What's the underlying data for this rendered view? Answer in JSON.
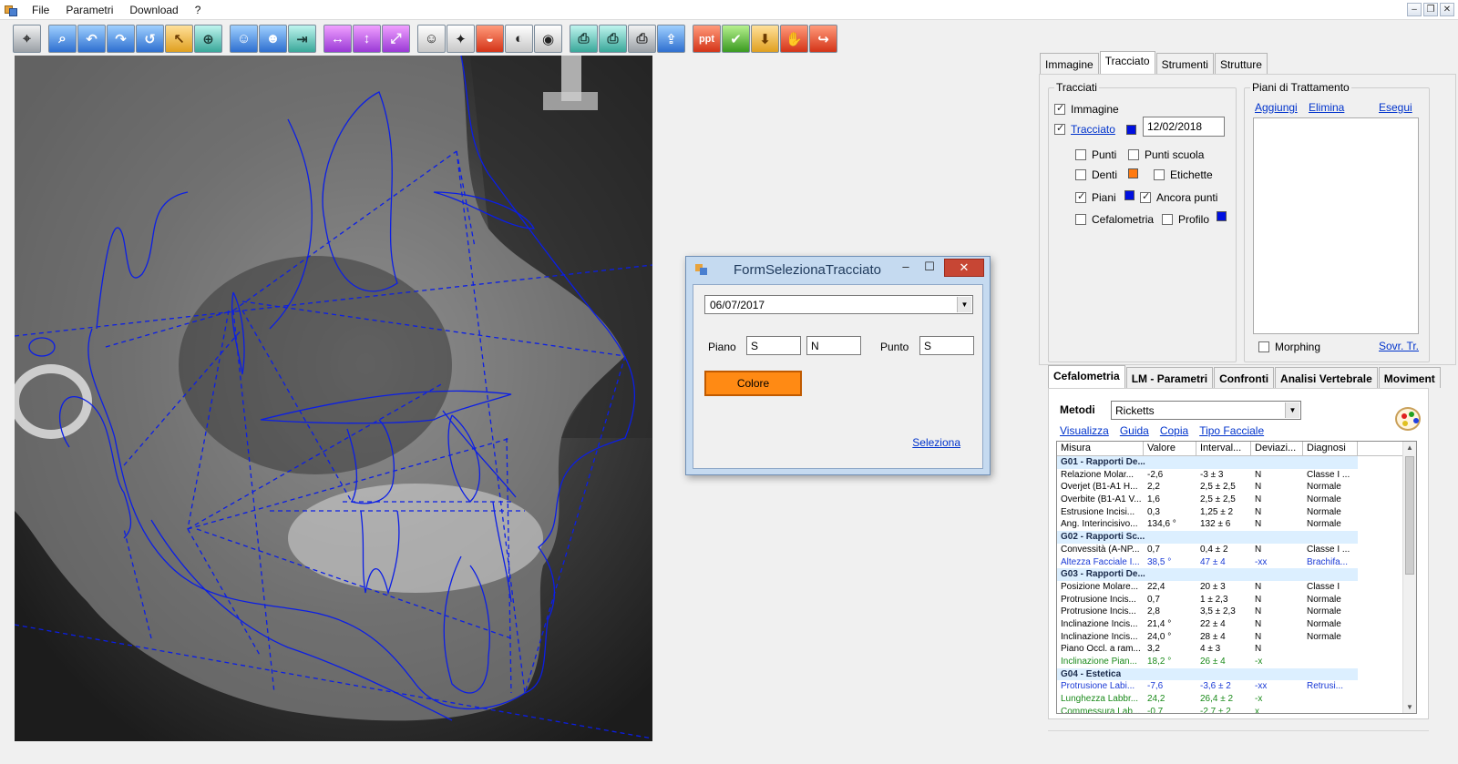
{
  "menu": {
    "items": [
      "File",
      "Parametri",
      "Download",
      "?"
    ]
  },
  "toolbar": {
    "groups": [
      [
        {
          "icon": "ruler-icon",
          "style": "tb-gray",
          "glyph": "⌖"
        }
      ],
      [
        {
          "icon": "zoom-icon",
          "style": "tb-blue",
          "glyph": "⌕"
        },
        {
          "icon": "rotate-left-icon",
          "style": "tb-blue",
          "glyph": "↶"
        },
        {
          "icon": "rotate-right-icon",
          "style": "tb-blue",
          "glyph": "↷"
        },
        {
          "icon": "reset-view-icon",
          "style": "tb-blue",
          "glyph": "↺"
        },
        {
          "icon": "pointer-icon",
          "style": "tb-orange",
          "glyph": "↖"
        },
        {
          "icon": "magnifier-icon",
          "style": "tb-teal",
          "glyph": "⊕"
        }
      ],
      [
        {
          "icon": "patient-icon",
          "style": "tb-blue",
          "glyph": "☺"
        },
        {
          "icon": "patient-search-icon",
          "style": "tb-blue",
          "glyph": "☻"
        },
        {
          "icon": "import-icon",
          "style": "tb-teal",
          "glyph": "⇥"
        }
      ],
      [
        {
          "icon": "flip-horizontal-icon",
          "style": "tb-purple",
          "glyph": "↔"
        },
        {
          "icon": "flip-vertical-icon",
          "style": "tb-purple",
          "glyph": "↕"
        },
        {
          "icon": "resize-icon",
          "style": "tb-purple",
          "glyph": "⤢"
        }
      ],
      [
        {
          "icon": "profile-photo-icon",
          "style": "tb-dark",
          "glyph": "☺"
        },
        {
          "icon": "wand-icon",
          "style": "tb-dark",
          "glyph": "✦"
        },
        {
          "icon": "mouth-icon",
          "style": "tb-red",
          "glyph": "◒"
        },
        {
          "icon": "face-profile-icon",
          "style": "tb-dark",
          "glyph": "◐"
        },
        {
          "icon": "eye-icon",
          "style": "tb-dark",
          "glyph": "◉"
        }
      ],
      [
        {
          "icon": "print-icon",
          "style": "tb-teal",
          "glyph": "⎙"
        },
        {
          "icon": "print-preview-icon",
          "style": "tb-teal",
          "glyph": "⎙"
        },
        {
          "icon": "print-setup-icon",
          "style": "tb-gray",
          "glyph": "⎙"
        },
        {
          "icon": "export-icon",
          "style": "tb-blue",
          "glyph": "⇪"
        }
      ],
      [
        {
          "icon": "powerpoint-icon",
          "style": "tb-red",
          "glyph": "ppt"
        },
        {
          "icon": "check-icon",
          "style": "tb-green",
          "glyph": "✔"
        },
        {
          "icon": "download-icon",
          "style": "tb-orange",
          "glyph": "⬇"
        },
        {
          "icon": "hand-icon",
          "style": "tb-red",
          "glyph": "✋"
        },
        {
          "icon": "exit-icon",
          "style": "tb-red",
          "glyph": "↪"
        }
      ]
    ]
  },
  "dialog": {
    "title": "FormSelezionaTracciato",
    "date_value": "06/07/2017",
    "piano_label": "Piano",
    "piano_1": "S",
    "piano_2": "N",
    "punto_label": "Punto",
    "punto_value": "S",
    "colore_label": "Colore",
    "colore_color": "#ff8a14",
    "seleziona_label": "Seleziona"
  },
  "right_tabs": [
    "Immagine",
    "Tracciato",
    "Strumenti",
    "Strutture"
  ],
  "tracciati": {
    "title": "Tracciati",
    "immagine": "Immagine",
    "tracciato": "Tracciato",
    "date": "12/02/2018",
    "punti": "Punti",
    "punti_scuola": "Punti scuola",
    "denti": "Denti",
    "etichette": "Etichette",
    "piani": "Piani",
    "ancora_punti": "Ancora punti",
    "cefalometria": "Cefalometria",
    "profilo": "Profilo",
    "color_blue": "#0010e0",
    "color_orange": "#ff7a10"
  },
  "piani_trattamento": {
    "title": "Piani di Trattamento",
    "aggiungi": "Aggiungi",
    "elimina": "Elimina",
    "esegui": "Esegui",
    "morphing": "Morphing",
    "sovr": "Sovr. Tr."
  },
  "bottom_tabs": [
    "Cefalometria",
    "LM - Parametri",
    "Confronti",
    "Analisi Vertebrale",
    "Moviment"
  ],
  "cefalometria": {
    "metodi_label": "Metodi",
    "metodi_value": "Ricketts",
    "actions": [
      "Visualizza",
      "Guida",
      "Copia",
      "Tipo Facciale"
    ],
    "columns": [
      "Misura",
      "Valore",
      "Interval...",
      "Deviazi...",
      "Diagnosi"
    ],
    "rows": [
      {
        "group": "G01 - Rapporti De..."
      },
      {
        "cells": [
          "Relazione Molar...",
          "-2,6",
          "-3 ± 3",
          "N",
          "Classe I ..."
        ],
        "color": "#000000"
      },
      {
        "cells": [
          "Overjet (B1-A1 H...",
          "2,2",
          "2,5 ± 2,5",
          "N",
          "Normale"
        ],
        "color": "#000000"
      },
      {
        "cells": [
          "Overbite (B1-A1 V...",
          "1,6",
          "2,5 ± 2,5",
          "N",
          "Normale"
        ],
        "color": "#000000"
      },
      {
        "cells": [
          "Estrusione Incisi...",
          "0,3",
          "1,25 ± 2",
          "N",
          "Normale"
        ],
        "color": "#000000"
      },
      {
        "cells": [
          "Ang. Interincisivo...",
          "134,6 °",
          "132 ± 6",
          "N",
          "Normale"
        ],
        "color": "#000000"
      },
      {
        "group": "G02 - Rapporti Sc..."
      },
      {
        "cells": [
          "Convessità (A-NP...",
          "0,7",
          "0,4 ± 2",
          "N",
          "Classe I ..."
        ],
        "color": "#000000"
      },
      {
        "cells": [
          "Altezza Facciale I...",
          "38,5 °",
          "47 ± 4",
          "-xx",
          "Brachifa..."
        ],
        "color": "#1a3ad6"
      },
      {
        "group": "G03 - Rapporti De..."
      },
      {
        "cells": [
          "Posizione Molare...",
          "22,4",
          "20 ± 3",
          "N",
          "Classe I"
        ],
        "color": "#000000"
      },
      {
        "cells": [
          "Protrusione Incis...",
          "0,7",
          "1 ± 2,3",
          "N",
          "Normale"
        ],
        "color": "#000000"
      },
      {
        "cells": [
          "Protrusione Incis...",
          "2,8",
          "3,5 ± 2,3",
          "N",
          "Normale"
        ],
        "color": "#000000"
      },
      {
        "cells": [
          "Inclinazione Incis...",
          "21,4 °",
          "22 ± 4",
          "N",
          "Normale"
        ],
        "color": "#000000"
      },
      {
        "cells": [
          "Inclinazione Incis...",
          "24,0 °",
          "28 ± 4",
          "N",
          "Normale"
        ],
        "color": "#000000"
      },
      {
        "cells": [
          "Piano Occl. a ram...",
          "3,2",
          "4 ± 3",
          "N",
          ""
        ],
        "color": "#000000"
      },
      {
        "cells": [
          "Inclinazione Pian...",
          "18,2 °",
          "26 ± 4",
          "-x",
          ""
        ],
        "color": "#1a8a1a"
      },
      {
        "group": "G04 - Estetica"
      },
      {
        "cells": [
          "Protrusione Labi...",
          "-7,6",
          "-3,6 ± 2",
          "-xx",
          "Retrusi..."
        ],
        "color": "#1a3ad6"
      },
      {
        "cells": [
          "Lunghezza Labbr...",
          "24,2",
          "26,4 ± 2",
          "-x",
          ""
        ],
        "color": "#1a8a1a"
      },
      {
        "cells": [
          "Commessura Lab...",
          "-0,7",
          "-2,7 ± 2",
          "x",
          ""
        ],
        "color": "#1a8a1a"
      }
    ]
  }
}
